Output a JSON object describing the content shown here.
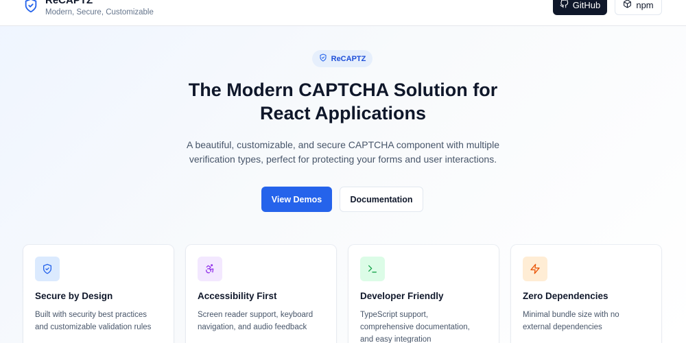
{
  "header": {
    "brand_name": "ReCAPTZ",
    "tagline": "Modern, Secure, Customizable",
    "github_label": "GitHub",
    "npm_label": "npm"
  },
  "hero": {
    "badge": "ReCAPTZ",
    "title_line1": "The Modern CAPTCHA Solution for",
    "title_line2": "React Applications",
    "subtitle_line1": "A beautiful, customizable, and secure CAPTCHA component with multiple",
    "subtitle_line2": "verification types, perfect for protecting your forms and user interactions.",
    "primary_button": "View Demos",
    "secondary_button": "Documentation"
  },
  "features": [
    {
      "title": "Secure by Design",
      "desc_line1": "Built with security best practices",
      "desc_line2": "and customizable validation rules",
      "icon": "shield-icon",
      "icon_color": "#2563eb",
      "icon_bg": "#dbeafe"
    },
    {
      "title": "Accessibility First",
      "desc_line1": "Screen reader support, keyboard",
      "desc_line2": "navigation, and audio feedback",
      "icon": "accessibility-icon",
      "icon_color": "#9333ea",
      "icon_bg": "#f3e8ff"
    },
    {
      "title": "Developer Friendly",
      "desc_line1": "TypeScript support,",
      "desc_line2": "comprehensive documentation,",
      "desc_line3": "and easy integration",
      "icon": "terminal-icon",
      "icon_color": "#16a34a",
      "icon_bg": "#dcfce7"
    },
    {
      "title": "Zero Dependencies",
      "desc_line1": "Minimal bundle size with no",
      "desc_line2": "external dependencies",
      "icon": "zap-icon",
      "icon_color": "#ea580c",
      "icon_bg": "#ffedd5"
    }
  ],
  "colors": {
    "primary": "#2563eb",
    "dark": "#0f172a",
    "muted": "#64748b"
  }
}
